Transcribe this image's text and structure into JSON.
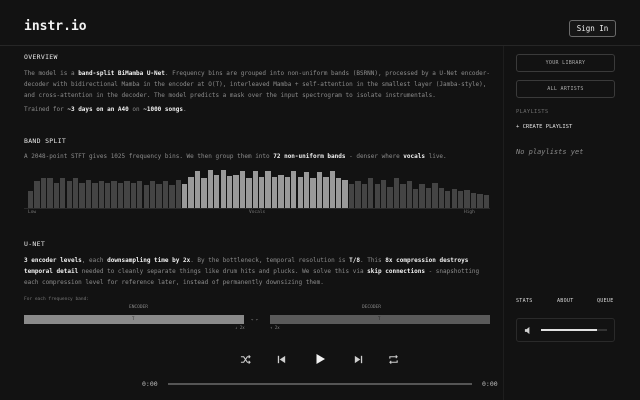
{
  "app": {
    "title": "instr.io",
    "sign_in": "Sign In"
  },
  "overview": {
    "heading": "OVERVIEW",
    "p1_a": "The model is a ",
    "p1_b": "band-split BiMamba U-Net",
    "p1_c": ". Frequency bins are grouped into non-uniform bands (BSRNN), processed by a U-Net encoder-decoder with bidirectional Mamba in the encoder at O(T), interleaved Mamba + self-attention in the smallest layer (Jamba-style), and cross-attention in the decoder. The model predicts a mask over the input spectrogram to isolate instrumentals.",
    "p2_a": "Trained for ",
    "p2_b": "~3 days on an A40",
    "p2_c": " on ",
    "p2_d": "~1000 songs",
    "p2_e": "."
  },
  "band_split": {
    "heading": "BAND SPLIT",
    "p_a": "A 2048-point STFT gives 1025 frequency bins. We then group them into ",
    "p_b": "72 non-uniform bands",
    "p_c": " - denser where ",
    "p_d": "vocals",
    "p_e": " live.",
    "label_low": "Low",
    "label_vocals": "Vocals",
    "label_high": "High",
    "bar_levels": [
      0.45,
      0.72,
      0.78,
      0.78,
      0.65,
      0.8,
      0.72,
      0.8,
      0.65,
      0.75,
      0.65,
      0.72,
      0.65,
      0.72,
      0.65,
      0.7,
      0.65,
      0.72,
      0.6,
      0.72,
      0.62,
      0.72,
      0.6,
      0.75,
      0.62,
      0.82,
      0.97,
      0.8,
      1.0,
      0.88,
      1.0,
      0.85,
      0.88,
      0.97,
      0.78,
      0.97,
      0.82,
      0.97,
      0.82,
      0.88,
      0.82,
      0.97,
      0.82,
      0.95,
      0.78,
      0.95,
      0.82,
      0.97,
      0.78,
      0.75,
      0.62,
      0.72,
      0.62,
      0.8,
      0.62,
      0.75,
      0.55,
      0.78,
      0.62,
      0.72,
      0.5,
      0.62,
      0.52,
      0.65,
      0.52,
      0.45,
      0.5,
      0.45,
      0.48,
      0.4,
      0.38,
      0.35
    ],
    "vocal_range": [
      24,
      49
    ]
  },
  "unet": {
    "heading": "U-NET",
    "p_a": "3 encoder levels",
    "p_b": ", each ",
    "p_c": "downsampling time by 2x",
    "p_d": ". By the bottleneck, temporal resolution is ",
    "p_e": "T/8",
    "p_f": ". This ",
    "p_g": "8x compression destroys temporal detail",
    "p_h": " needed to cleanly separate things like drum hits and plucks. We solve this via ",
    "p_i": "skip connections",
    "p_j": " - snapshotting each compression level for reference later, instead of permanently downsizing them.",
    "caption": "For each frequency band:",
    "encoder_label": "ENCODER",
    "decoder_label": "DECODER",
    "enc_t": "T",
    "dec_t": "T",
    "enc_down": "↓ 2x",
    "dec_up": "↑ 2x",
    "mid": "→ ←"
  },
  "sidebar": {
    "your_library": "YOUR LIBRARY",
    "all_artists": "ALL ARTISTS",
    "playlists": "PLAYLISTS",
    "create_playlist": "+ CREATE PLAYLIST",
    "no_playlists": "No playlists yet",
    "tab_stats": "STATS",
    "tab_about": "ABOUT",
    "tab_queue": "QUEUE",
    "volume_level": 0.85
  },
  "player": {
    "time_current": "0:00",
    "time_total": "0:00",
    "progress": 0.0
  },
  "colors": {
    "bg": "#121212",
    "text": "#bdbdbd",
    "accent": "#f0f0f0",
    "vocal_bar": "#9a9a9a",
    "bar": "#444444"
  }
}
